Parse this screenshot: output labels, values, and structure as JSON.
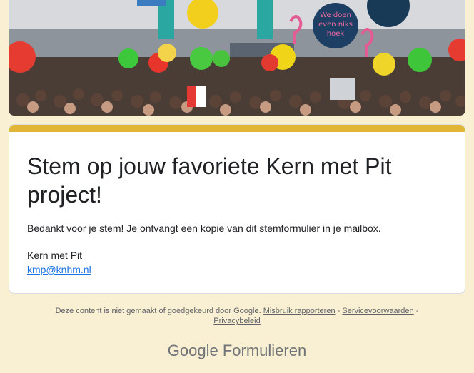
{
  "form": {
    "title": "Stem op jouw favoriete Kern met Pit project!",
    "confirmation_message": "Bedankt voor je stem! Je ontvangt een kopie van dit stemformulier in je mailbox.",
    "organization": "Kern met Pit",
    "contact_email": "kmp@knhm.nl",
    "accent_color": "#e2b537",
    "background_color": "#f9efd2"
  },
  "header_image": {
    "banner_texts": [
      "We doen even niks hoek"
    ]
  },
  "footer": {
    "disclaimer": "Deze content is niet gemaakt of goedgekeurd door Google.",
    "report_abuse": "Misbruik rapporteren",
    "separator": "-",
    "terms": "Servicevoorwaarden",
    "privacy": "Privacybeleid",
    "brand_google": "Google",
    "brand_product": "Formulieren"
  }
}
